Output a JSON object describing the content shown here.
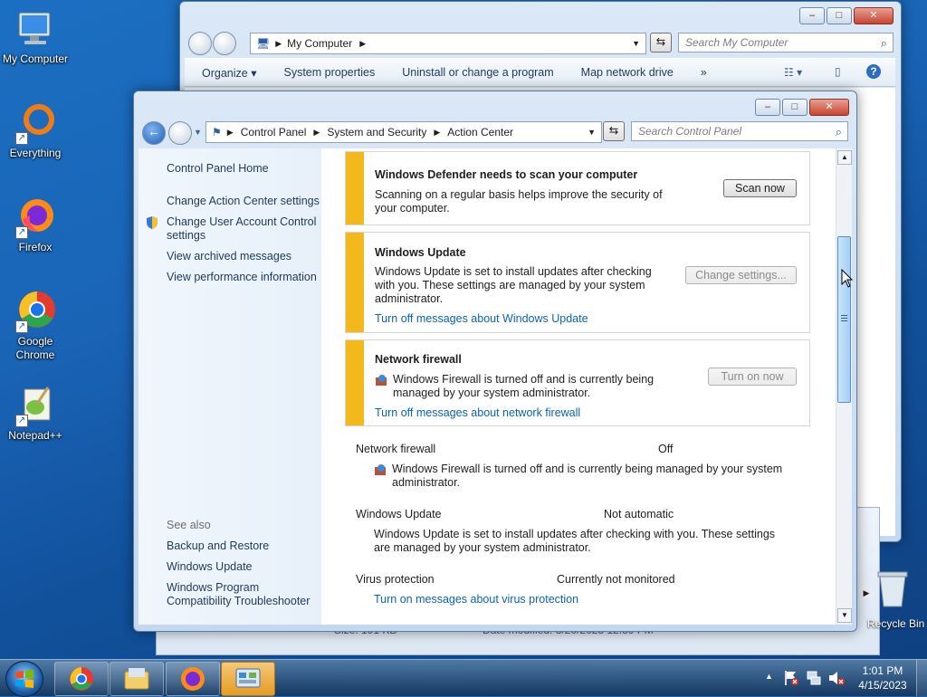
{
  "desktop": {
    "icons": [
      {
        "label": "My Computer"
      },
      {
        "label": "Everything"
      },
      {
        "label": "Firefox"
      },
      {
        "label": "Google Chrome"
      },
      {
        "label": "Notepad++"
      },
      {
        "label": "Recycle Bin"
      }
    ]
  },
  "explorer": {
    "address": [
      "My Computer"
    ],
    "search_placeholder": "Search My Computer",
    "toolbar": [
      "Organize",
      "System properties",
      "Uninstall or change a program",
      "Map network drive",
      "»"
    ],
    "status_size": "Size: 191 KB",
    "status_modified": "Date modified: 3/20/2023 12:39 PM"
  },
  "control_panel": {
    "address": [
      "Control Panel",
      "System and Security",
      "Action Center"
    ],
    "search_placeholder": "Search Control Panel",
    "left": {
      "home": "Control Panel Home",
      "links": [
        "Change Action Center settings",
        "Change User Account Control settings",
        "View archived messages",
        "View performance information"
      ],
      "see_also": "See also",
      "see_also_links": [
        "Backup and Restore",
        "Windows Update",
        "Windows Program Compatibility Troubleshooter"
      ]
    },
    "cards": {
      "defender": {
        "title": "Windows Defender needs to scan your computer",
        "text": "Scanning on a regular basis helps improve the security of your computer.",
        "button": "Scan now"
      },
      "update": {
        "title": "Windows Update",
        "text": "Windows Update is set to install updates after checking with you.  These settings are managed by your system administrator.",
        "link": "Turn off messages about Windows Update",
        "button": "Change settings..."
      },
      "firewall": {
        "title": "Network firewall",
        "text": "Windows Firewall is turned off and is currently being managed by your system administrator.",
        "link": "Turn off messages about network firewall",
        "button": "Turn on now"
      }
    },
    "details": [
      {
        "label": "Network firewall",
        "status": "Off",
        "text": "Windows Firewall is turned off and is currently being managed by your system administrator."
      },
      {
        "label": "Windows Update",
        "status": "Not automatic",
        "text": "Windows Update is set to install updates after checking with you.  These settings are managed by your system administrator."
      },
      {
        "label": "Virus protection",
        "status": "Currently not monitored",
        "link": "Turn on messages about virus protection"
      }
    ]
  },
  "taskbar": {
    "time": "1:01 PM",
    "date": "4/15/2023"
  },
  "colors": {
    "alert_bar": "#f3b81b",
    "link": "#0a64b4",
    "nav_text": "#1e395b"
  }
}
